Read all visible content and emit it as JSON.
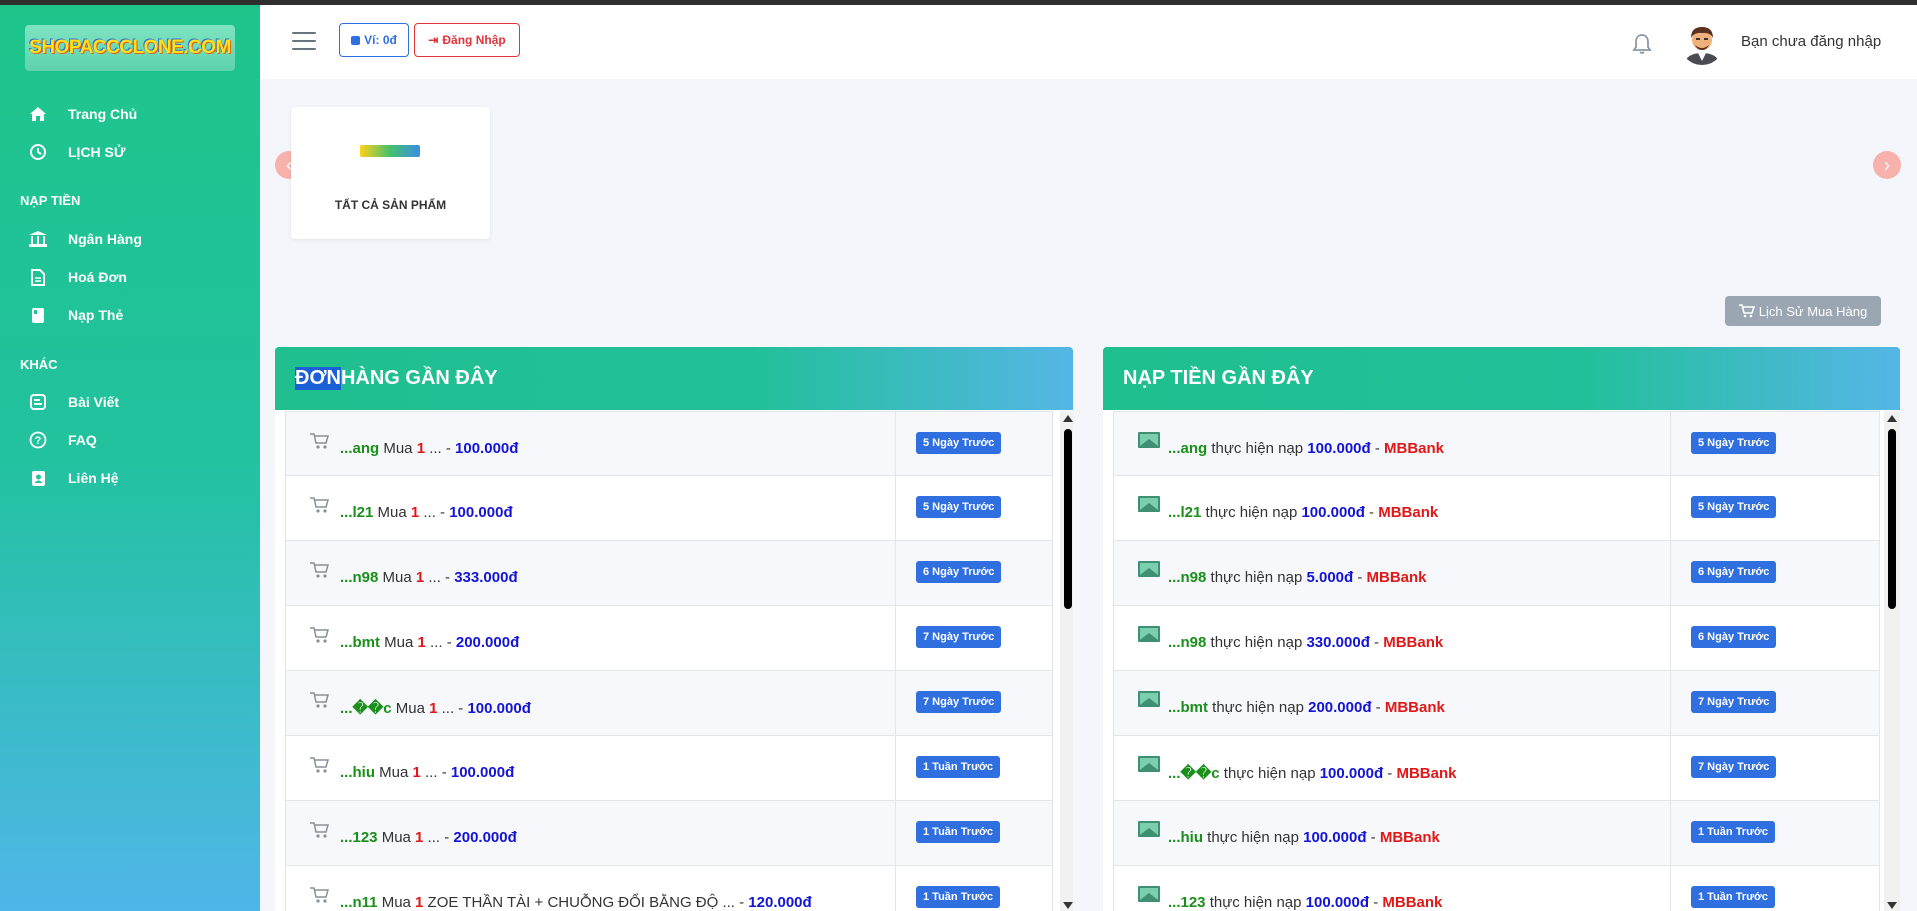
{
  "sidebar": {
    "logo_text": "SHOPACCCLONE.COM",
    "items_main": [
      {
        "label": "Trang Chủ",
        "icon": "home-icon"
      },
      {
        "label": "LỊCH SỬ",
        "icon": "history-icon"
      }
    ],
    "section_deposit": "NẠP TIỀN",
    "items_deposit": [
      {
        "label": "Ngân Hàng",
        "icon": "bank-icon"
      },
      {
        "label": "Hoá Đơn",
        "icon": "invoice-icon"
      },
      {
        "label": "Nạp Thẻ",
        "icon": "card-icon"
      }
    ],
    "section_other": "KHÁC",
    "items_other": [
      {
        "label": "Bài Viết",
        "icon": "blog-icon"
      },
      {
        "label": "FAQ",
        "icon": "question-icon"
      },
      {
        "label": "Liên Hệ",
        "icon": "contact-icon"
      }
    ]
  },
  "header": {
    "wallet_label": "Ví: 0đ",
    "login_label": "Đăng Nhập",
    "user_status": "Bạn chưa đăng nhập"
  },
  "products": {
    "card_label": "TẤT CẢ SẢN PHẨM",
    "prev": "‹",
    "next": "›"
  },
  "history_button": "Lịch Sử Mua Hàng",
  "orders": {
    "title_highlight": "ĐƠN",
    "title_rest": " HÀNG GẦN ĐÂY",
    "rows": [
      {
        "user": "...ang",
        "mua": " Mua ",
        "qty": "1",
        "mid": " ... - ",
        "price": "100.000đ",
        "time": "5 Ngày Trước"
      },
      {
        "user": "...l21",
        "mua": " Mua ",
        "qty": "1",
        "mid": " ... - ",
        "price": "100.000đ",
        "time": "5 Ngày Trước"
      },
      {
        "user": "...n98",
        "mua": " Mua ",
        "qty": "1",
        "mid": " ... - ",
        "price": "333.000đ",
        "time": "6 Ngày Trước"
      },
      {
        "user": "...bmt",
        "mua": " Mua ",
        "qty": "1",
        "mid": " ... - ",
        "price": "200.000đ",
        "time": "7 Ngày Trước"
      },
      {
        "user": "...��c",
        "mua": " Mua ",
        "qty": "1",
        "mid": " ... - ",
        "price": "100.000đ",
        "time": "7 Ngày Trước"
      },
      {
        "user": "...hiu",
        "mua": " Mua ",
        "qty": "1",
        "mid": " ... - ",
        "price": "100.000đ",
        "time": "1 Tuần Trước"
      },
      {
        "user": "...123",
        "mua": " Mua ",
        "qty": "1",
        "mid": " ... - ",
        "price": "200.000đ",
        "time": "1 Tuần Trước"
      },
      {
        "user": "...n11",
        "mua": " Mua ",
        "qty": "1",
        "mid": " ZOE THẦN TÀI + CHUỖNG ĐỔI BẰNG ĐỘ ... - ",
        "price": "120.000đ",
        "time": "1 Tuần Trước"
      }
    ]
  },
  "deposits": {
    "title": "NẠP TIỀN GẦN ĐÂY",
    "rows": [
      {
        "user": "...ang",
        "text": " thực hiện nạp ",
        "amount": "100.000đ",
        "sep": " - ",
        "bank": "MBBank",
        "time": "5 Ngày Trước"
      },
      {
        "user": "...l21",
        "text": " thực hiện nạp ",
        "amount": "100.000đ",
        "sep": " - ",
        "bank": "MBBank",
        "time": "5 Ngày Trước"
      },
      {
        "user": "...n98",
        "text": " thực hiện nạp ",
        "amount": "5.000đ",
        "sep": " - ",
        "bank": "MBBank",
        "time": "6 Ngày Trước"
      },
      {
        "user": "...n98",
        "text": " thực hiện nạp ",
        "amount": "330.000đ",
        "sep": " - ",
        "bank": "MBBank",
        "time": "6 Ngày Trước"
      },
      {
        "user": "...bmt",
        "text": " thực hiện nạp ",
        "amount": "200.000đ",
        "sep": " - ",
        "bank": "MBBank",
        "time": "7 Ngày Trước"
      },
      {
        "user": "...��c",
        "text": " thực hiện nạp ",
        "amount": "100.000đ",
        "sep": " - ",
        "bank": "MBBank",
        "time": "7 Ngày Trước"
      },
      {
        "user": "...hiu",
        "text": " thực hiện nạp ",
        "amount": "100.000đ",
        "sep": " - ",
        "bank": "MBBank",
        "time": "1 Tuần Trước"
      },
      {
        "user": "...123",
        "text": " thực hiện nạp ",
        "amount": "100.000đ",
        "sep": " - ",
        "bank": "MBBank",
        "time": "1 Tuần Trước"
      }
    ]
  }
}
